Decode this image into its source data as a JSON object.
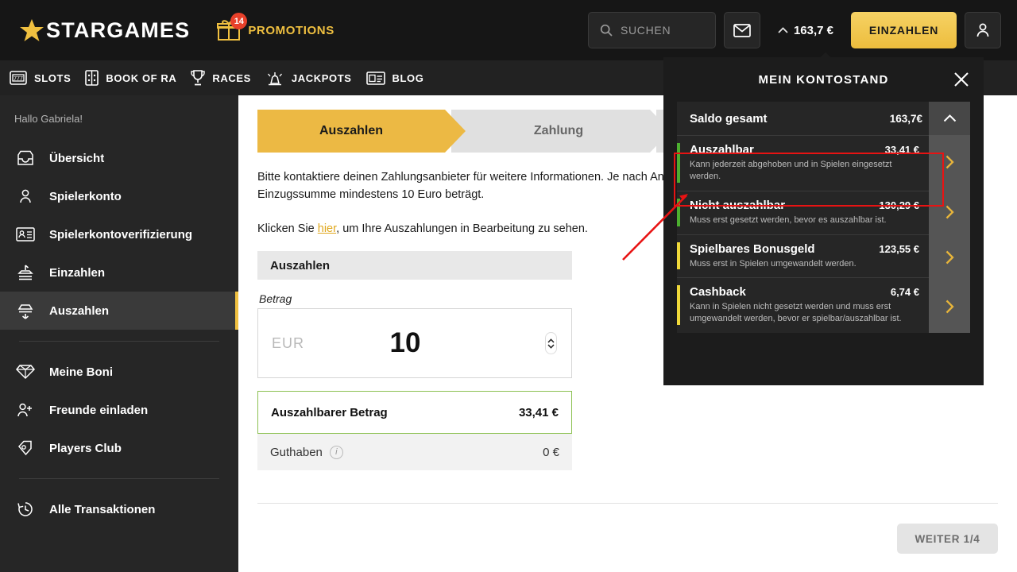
{
  "header": {
    "logo_text": "STARGAMES",
    "logo_icon": "star-icon",
    "promotions_label": "PROMOTIONS",
    "promotions_badge": "14",
    "promotions_icon": "gift-icon",
    "search_placeholder": "SUCHEN",
    "search_icon": "search-icon",
    "mail_icon": "envelope-icon",
    "balance_value": "163,7 €",
    "balance_caret_icon": "chevron-up-icon",
    "deposit_label": "EINZAHLEN",
    "account_icon": "user-icon"
  },
  "nav": {
    "items": [
      {
        "label": "SLOTS",
        "icon": "slot-machine-icon"
      },
      {
        "label": "BOOK OF RA",
        "icon": "book-icon"
      },
      {
        "label": "RACES",
        "icon": "trophy-icon"
      },
      {
        "label": "JACKPOTS",
        "icon": "jackpot-icon"
      },
      {
        "label": "BLOG",
        "icon": "article-icon"
      }
    ]
  },
  "sidebar": {
    "greeting": "Hallo Gabriela!",
    "group1": [
      {
        "label": "Übersicht",
        "icon": "overview-icon",
        "active": false
      },
      {
        "label": "Spielerkonto",
        "icon": "user-icon",
        "active": false
      },
      {
        "label": "Spielerkontoverifizierung",
        "icon": "id-card-icon",
        "active": false
      },
      {
        "label": "Einzahlen",
        "icon": "deposit-icon",
        "active": false
      },
      {
        "label": "Auszahlen",
        "icon": "withdraw-icon",
        "active": true
      }
    ],
    "group2": [
      {
        "label": "Meine Boni",
        "icon": "diamond-icon"
      },
      {
        "label": "Freunde einladen",
        "icon": "user-plus-icon"
      },
      {
        "label": "Players Club",
        "icon": "tag-icon"
      }
    ],
    "group3": [
      {
        "label": "Alle Transaktionen",
        "icon": "history-icon"
      }
    ]
  },
  "main": {
    "steps": [
      {
        "label": "Auszahlen",
        "state": "active"
      },
      {
        "label": "Zahlung",
        "state": "inactive"
      },
      {
        "label": "",
        "state": "inactive"
      }
    ],
    "info_line1": "Bitte kontaktiere deinen Zahlungsanbieter für weitere Informationen. Je nach Anbieter kann es sein, dass die",
    "info_line2": "Einzugssumme mindestens 10 Euro beträgt.",
    "info_line3_pre": "Klicken Sie ",
    "info_line3_link": "hier",
    "info_line3_post": ", um Ihre Auszahlungen in Bearbeitung zu sehen.",
    "panel_title": "Auszahlen",
    "amount_label": "Betrag",
    "currency": "EUR",
    "amount_value": "10",
    "stepper_up_icon": "chevron-up-icon",
    "stepper_down_icon": "chevron-down-icon",
    "payable_label": "Auszahlbarer Betrag",
    "payable_value": "33,41 €",
    "credit_label": "Guthaben",
    "credit_info_icon": "info-icon",
    "credit_value": "0 €",
    "next_button": "WEITER 1/4"
  },
  "balance_dropdown": {
    "title": "MEIN KONTOSTAND",
    "close_icon": "close-icon",
    "total_label": "Saldo gesamt",
    "total_value": "163,7€",
    "collapse_icon": "chevron-up-icon",
    "rows": [
      {
        "name": "Auszahlbar",
        "value": "33,41 €",
        "desc": "Kann jederzeit abgehoben und in Spielen eingesetzt werden.",
        "bar": "green",
        "chevron_icon": "chevron-right-icon",
        "highlighted": true
      },
      {
        "name": "Nicht auszahlbar",
        "value": "130,29 €",
        "desc": "Muss erst gesetzt werden, bevor es auszahlbar ist.",
        "bar": "green",
        "chevron_icon": "chevron-right-icon",
        "highlighted": false
      },
      {
        "name": "Spielbares Bonusgeld",
        "value": "123,55 €",
        "desc": "Muss erst in Spielen umgewandelt werden.",
        "bar": "yellow",
        "chevron_icon": "chevron-right-icon",
        "highlighted": false
      },
      {
        "name": "Cashback",
        "value": "6,74 €",
        "desc": "Kann in Spielen nicht gesetzt werden und muss erst umgewandelt werden, bevor er spielbar/auszahlbar ist.",
        "bar": "yellow",
        "chevron_icon": "chevron-right-icon",
        "highlighted": false
      }
    ]
  },
  "annotation": {
    "highlight_color": "#e81313",
    "arrow_icon": "arrow-pointer"
  },
  "colors": {
    "brand_yellow": "#f0c040",
    "header_bg": "#161616",
    "nav_bg": "#222222",
    "sidebar_bg": "#262626",
    "green": "#4caf2f",
    "red": "#e81313"
  }
}
